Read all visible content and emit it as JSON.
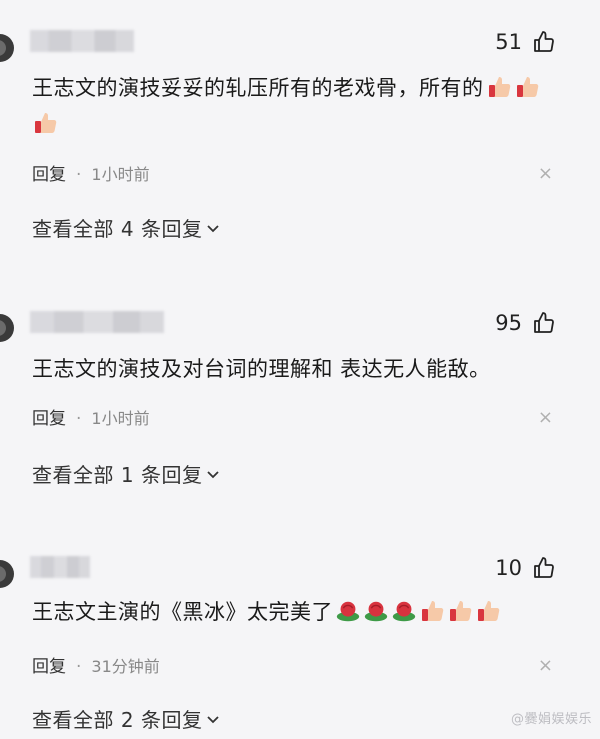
{
  "comments": [
    {
      "likes": "51",
      "text": "王志文的演技妥妥的轧压所有的老戏骨，所有的",
      "reply_label": "回复",
      "time": "1小时前",
      "view_replies": "查看全部 4 条回复"
    },
    {
      "likes": "95",
      "text": "王志文的演技及对台词的理解和 表达无人能敌。",
      "reply_label": "回复",
      "time": "1小时前",
      "view_replies": "查看全部 1 条回复"
    },
    {
      "likes": "10",
      "text": "王志文主演的《黑冰》太完美了",
      "reply_label": "回复",
      "time": "31分钟前",
      "view_replies": "查看全部 2 条回复"
    }
  ],
  "watermark": "@爨娟娱娱乐",
  "icons": {
    "like": "thumbs-up-outline-icon",
    "close": "close-icon",
    "chevron": "chevron-down-icon",
    "emoji_thumb": "thumbs-up-emoji",
    "emoji_rose": "rose-emoji"
  },
  "colors": {
    "background": "#f5f5f7",
    "text": "#1a1a1a",
    "muted": "#888888"
  }
}
